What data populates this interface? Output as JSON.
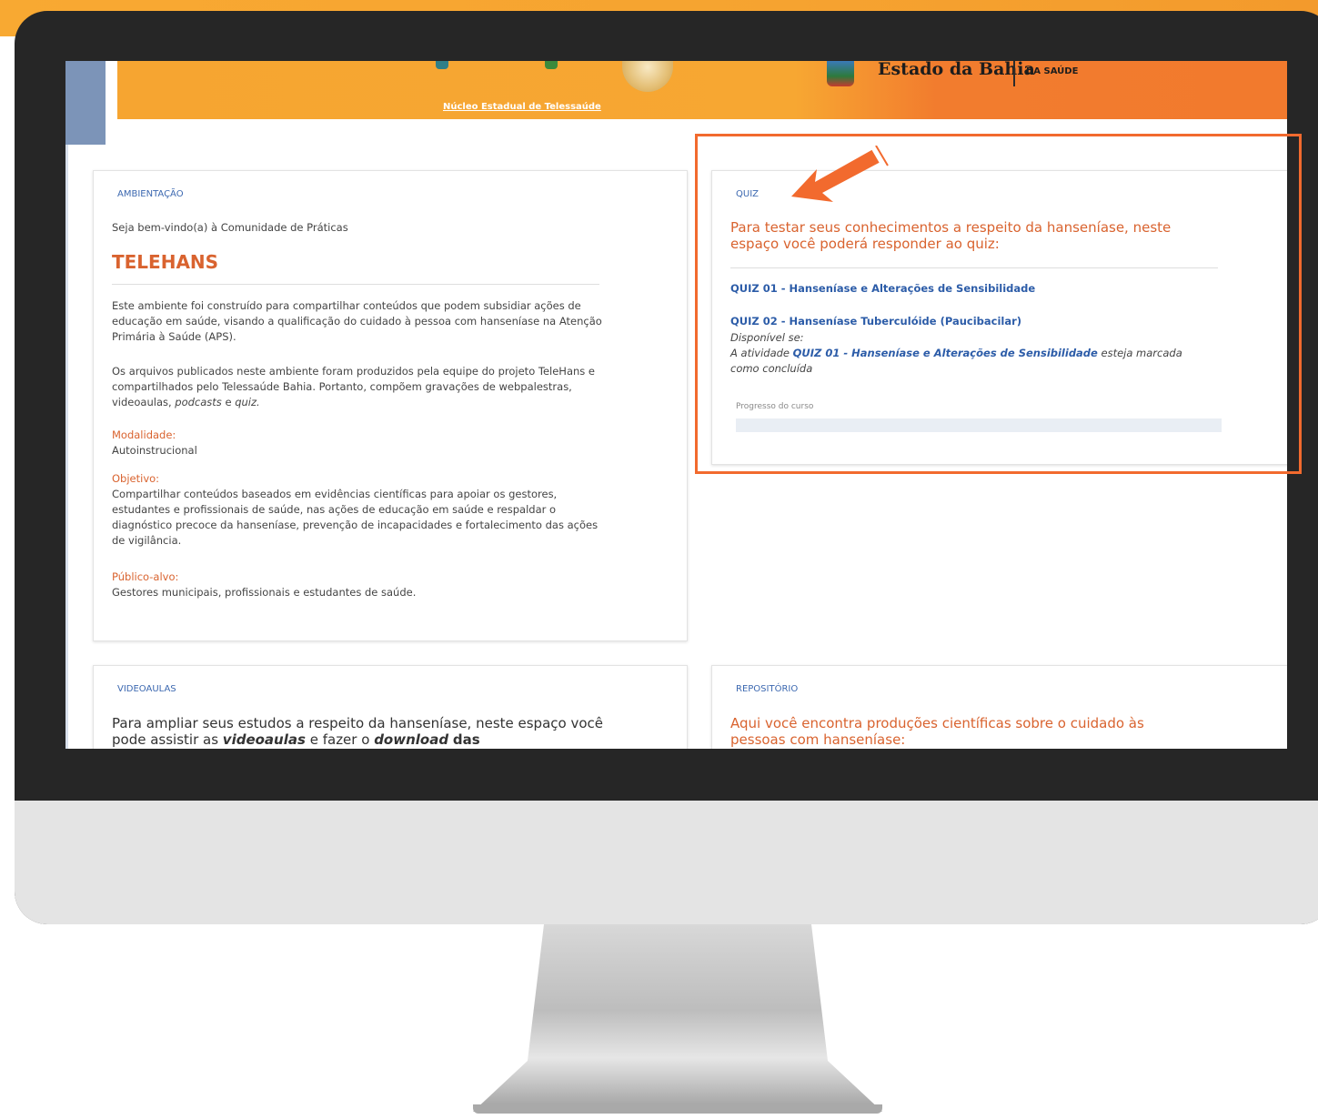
{
  "header": {
    "nucleo_caption": "Núcleo Estadual de Telessaúde",
    "estado_text": "Estado da Bahia",
    "saude_text": "DA SAÚDE"
  },
  "ambientacao": {
    "title": "AMBIENTAÇÃO",
    "welcome": "Seja bem-vindo(a) à Comunidade de Práticas",
    "heading": "TELEHANS",
    "para1": "Este ambiente foi construído para compartilhar conteúdos que podem subsidiar ações de educação em saúde, visando a qualificação do cuidado à pessoa com hanseníase na Atenção Primária à Saúde (APS).",
    "para2_main": "Os arquivos publicados neste ambiente foram produzidos pela equipe do projeto TeleHans e compartilhados pelo Telessaúde Bahia. Portanto, compõem gravações de webpalestras, videoaulas,",
    "para2_podcasts": "podcasts",
    "para2_e": "e",
    "para2_quiz": "quiz.",
    "modalidade_label": "Modalidade:",
    "modalidade_value": "Autoinstrucional",
    "objetivo_label": "Objetivo:",
    "objetivo_value": "Compartilhar conteúdos baseados em evidências científicas para apoiar os gestores, estudantes e profissionais de saúde, nas ações de educação em saúde e respaldar o diagnóstico precoce da hanseníase, prevenção de incapacidades e fortalecimento das ações de vigilância.",
    "publico_label": "Público-alvo:",
    "publico_value": "Gestores municipais, profissionais e estudantes de saúde."
  },
  "quiz": {
    "title": "QUIZ",
    "intro": "Para testar seus conhecimentos a respeito da hanseníase, neste espaço você poderá responder ao quiz:",
    "quiz1": "QUIZ 01 - Hanseníase e Alterações de Sensibilidade",
    "quiz2": "QUIZ 02 - Hanseníase Tuberculóide (Paucibacilar)",
    "disponivel": "Disponível se:",
    "cond_prefix": "A atividade",
    "cond_link": "QUIZ 01 - Hanseníase e Alterações de Sensibilidade",
    "cond_suffix": "esteja marcada como concluída",
    "progress_label": "Progresso do curso",
    "progress_value": 0
  },
  "videoaulas": {
    "title": "VIDEOAULAS",
    "intro_a": "Para ampliar seus estudos a respeito da hanseníase, neste espaço você pode assistir as",
    "intro_b": "videoaulas",
    "intro_c": "e fazer o",
    "intro_d": "download",
    "intro_e": "das"
  },
  "repositorio": {
    "title": "REPOSITÓRIO",
    "intro": "Aqui você encontra produções científicas sobre o cuidado às pessoas com hanseníase:"
  },
  "colors": {
    "accent_orange": "#f26a2e",
    "link_blue": "#2c5ca8",
    "title_blue": "#3c68b0"
  }
}
